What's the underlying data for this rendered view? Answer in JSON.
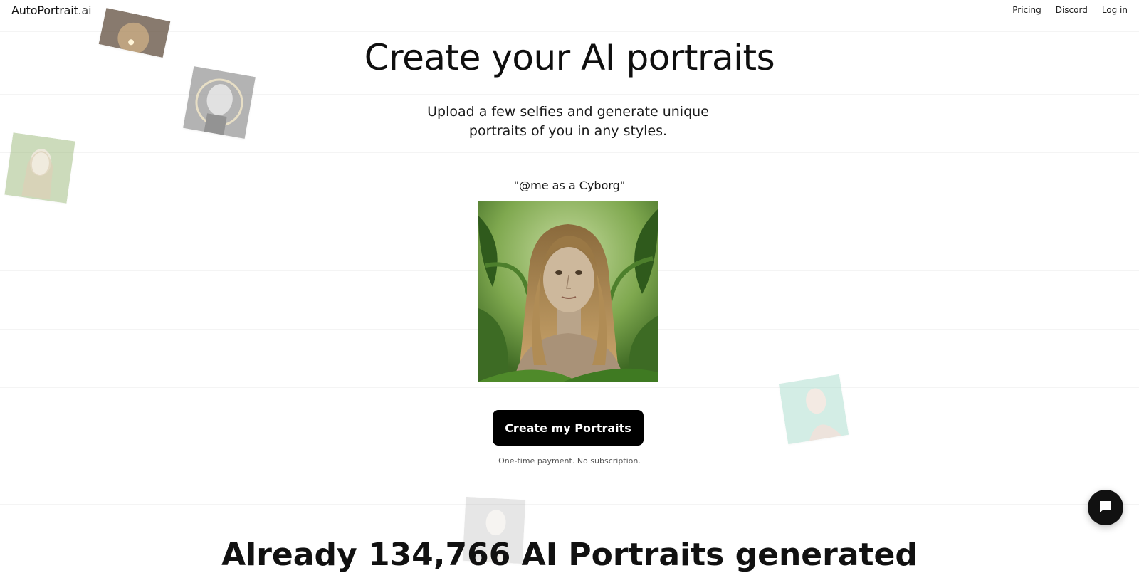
{
  "header": {
    "logo_main": "AutoPortrait",
    "logo_suffix": ".ai",
    "nav": [
      "Pricing",
      "Discord",
      "Log in"
    ]
  },
  "hero": {
    "title": "Create your AI portraits",
    "subtitle": "Upload a few selfies and generate unique portraits of you in any styles.",
    "prompt": "\"@me as a Cyborg\"",
    "cta_label": "Create my Portraits",
    "note": "One-time payment. No subscription."
  },
  "bottom": {
    "heading": "Already 134,766 AI Portraits generated"
  },
  "icons": {
    "chat": "chat-bubble-icon"
  },
  "colors": {
    "cta_background": "#000000",
    "chat_button": "#111111"
  }
}
